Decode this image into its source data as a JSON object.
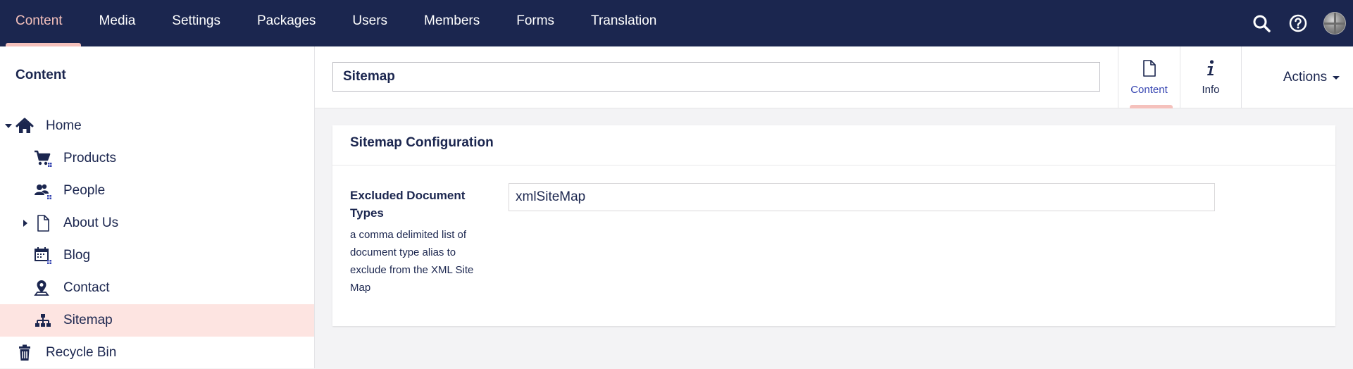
{
  "nav": {
    "items": [
      {
        "label": "Content",
        "active": true
      },
      {
        "label": "Media"
      },
      {
        "label": "Settings"
      },
      {
        "label": "Packages"
      },
      {
        "label": "Users"
      },
      {
        "label": "Members"
      },
      {
        "label": "Forms"
      },
      {
        "label": "Translation"
      }
    ],
    "icons": [
      "search-icon",
      "help-icon",
      "user-avatar"
    ]
  },
  "sidebar": {
    "title": "Content",
    "tree": [
      {
        "label": "Home",
        "icon": "home-icon",
        "expanded": true,
        "level": 0
      },
      {
        "label": "Products",
        "icon": "shopping-cart-icon",
        "level": 1
      },
      {
        "label": "People",
        "icon": "people-icon",
        "level": 1
      },
      {
        "label": "About Us",
        "icon": "document-icon",
        "level": 1,
        "collapsed": true
      },
      {
        "label": "Blog",
        "icon": "calendar-icon",
        "level": 1
      },
      {
        "label": "Contact",
        "icon": "map-pin-icon",
        "level": 1
      },
      {
        "label": "Sitemap",
        "icon": "sitemap-icon",
        "level": 1,
        "selected": true
      },
      {
        "label": "Recycle Bin",
        "icon": "trash-icon",
        "level": 0
      }
    ]
  },
  "header": {
    "name_value": "Sitemap",
    "tabs": [
      {
        "label": "Content",
        "icon": "document-icon",
        "active": true
      },
      {
        "label": "Info",
        "icon": "info-icon"
      }
    ],
    "actions_label": "Actions"
  },
  "panel": {
    "title": "Sitemap Configuration",
    "property": {
      "label": "Excluded Document Types",
      "description": "a comma delimited list of document type alias to exclude from the XML Site Map",
      "value": "xmlSiteMap"
    }
  },
  "colors": {
    "nav_bg": "#1b264f",
    "active_accent": "#f5c1bc",
    "selected_row": "#fde4e1",
    "text": "#1b264f"
  }
}
